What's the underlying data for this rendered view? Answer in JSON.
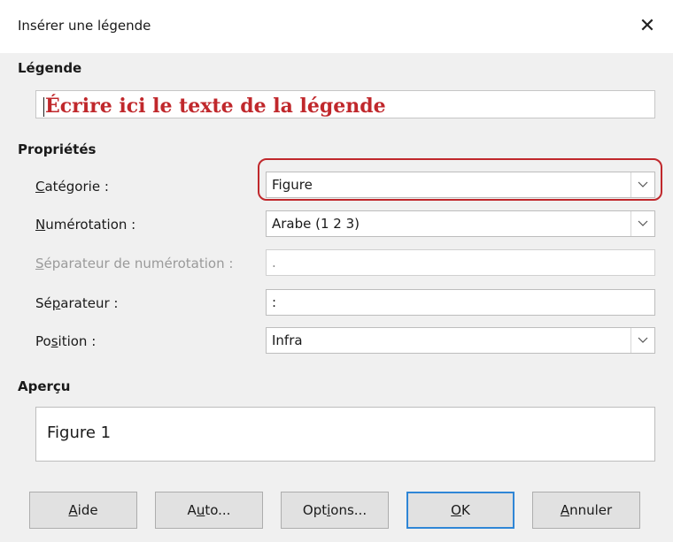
{
  "window": {
    "title": "Insérer une légende",
    "close_symbol": "✕"
  },
  "caption_section": {
    "title": "Légende",
    "input_value": "Écrire ici le texte de la légende"
  },
  "properties": {
    "title": "Propriétés",
    "category": {
      "label_prefix": "",
      "label_mnemonic": "C",
      "label_rest": "atégorie :",
      "value": "Figure"
    },
    "numbering": {
      "label_prefix": "",
      "label_mnemonic": "N",
      "label_rest": "umérotation :",
      "value": "Arabe (1 2 3)"
    },
    "numbering_separator": {
      "label_prefix": "",
      "label_mnemonic": "S",
      "label_rest": "éparateur de numérotation :",
      "value": "."
    },
    "separator": {
      "label_prefix": "Sé",
      "label_mnemonic": "p",
      "label_rest": "arateur :",
      "value": ":"
    },
    "position": {
      "label_prefix": "Po",
      "label_mnemonic": "s",
      "label_rest": "ition :",
      "value": "Infra"
    }
  },
  "preview": {
    "title": "Aperçu",
    "text": "Figure 1"
  },
  "buttons": {
    "help": {
      "mnemonic": "A",
      "rest": "ide"
    },
    "auto": {
      "prefix": "A",
      "mnemonic": "u",
      "rest": "to..."
    },
    "options": {
      "prefix": "Opt",
      "mnemonic": "i",
      "rest": "ons..."
    },
    "ok": {
      "mnemonic": "O",
      "rest": "K"
    },
    "cancel": {
      "mnemonic": "A",
      "rest": "nnuler"
    }
  },
  "colors": {
    "highlight": "#c0282c",
    "default_button_border": "#2f86d6"
  }
}
